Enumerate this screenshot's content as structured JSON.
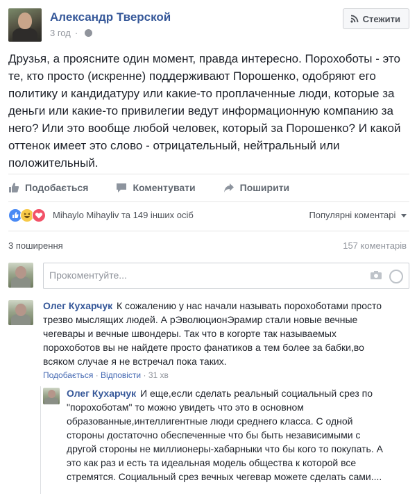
{
  "post": {
    "author": "Александр Тверской",
    "time": "3 год",
    "privacy_separator": "·",
    "follow_label": "Стежити",
    "text": "Друзья, а проясните один момент, правда интересно. Порохоботы - это те, кто просто (искренне) поддерживают Порошенко, одобряют его политику и кандидатуру или какие-то проплаченные люди, которые за деньги или какие-то привилегии ведут информационную компанию за него? Или это вообще любой человек, который за Порошенко? И какой оттенок имеет это слово - отрицательный, нейтральный или положительный."
  },
  "actions": {
    "like": "Подобається",
    "comment": "Коментувати",
    "share": "Поширити"
  },
  "reactions": {
    "summary": "Mihaylo Mihayliv та 149 інших осіб",
    "sort_label": "Популярні коментарі",
    "types": [
      "like",
      "haha",
      "love"
    ],
    "colors": {
      "like": "#4a8af4",
      "haha": "#f7c948",
      "love": "#f25268"
    }
  },
  "stats": {
    "shares": "3 поширення",
    "comments": "157 коментарів"
  },
  "composer": {
    "placeholder": "Прокоментуйте..."
  },
  "comments": [
    {
      "author": "Олег Кухарчук",
      "text": "К сожалению у нас начали называть порохоботами просто трезво мыслящих людей. А рЭволюционЭрамир стали новые вечные чегевары и вечные швондеры. Так что в когорте так называемых порохоботов вы не найдете просто фанатиков а тем более за бабки,во всяком случае я не встречал пока таких.",
      "like_label": "Подобається",
      "reply_label": "Відповісти",
      "time": "31 хв",
      "separator": "·"
    }
  ],
  "reply": {
    "author": "Олег Кухарчук",
    "text": "И еще,если сделать реальный социальный срез по \"порохоботам\" то можно увидеть что это в основном образованные,интеллигентные люди среднего класса. С одной стороны достаточно обеспеченные что бы быть независимыми с другой стороны не миллионеры-хабарныки что бы кого то покупать. А это как раз и есть та идеальная модель общества к которой все стремятся. Социальный срез вечных чегевар можете сделать сами...."
  },
  "colors": {
    "link": "#365899",
    "muted": "#90949c",
    "action": "#606770"
  }
}
